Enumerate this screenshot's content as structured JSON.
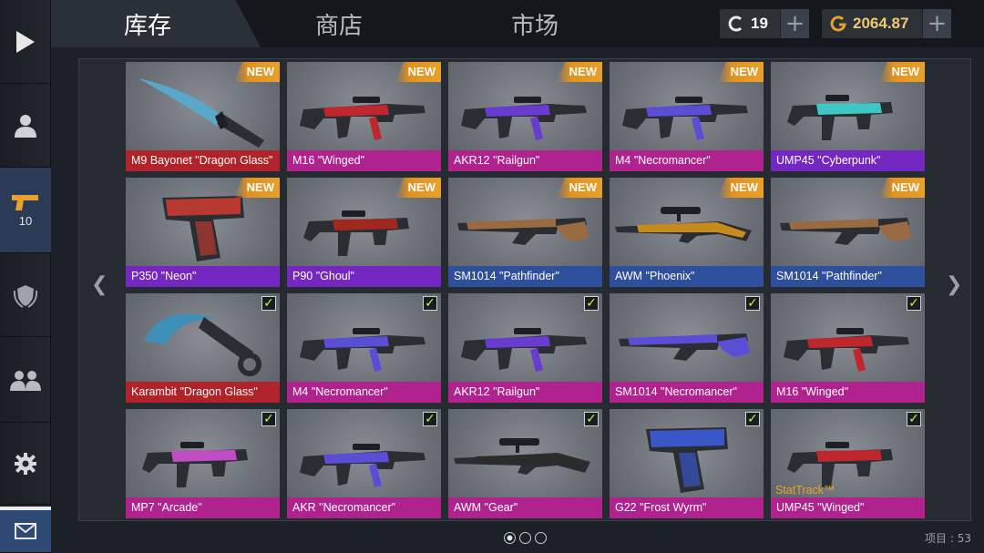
{
  "tabs": [
    {
      "label": "库存",
      "active": true
    },
    {
      "label": "商店",
      "active": false
    },
    {
      "label": "市场",
      "active": false
    }
  ],
  "currency": {
    "credits": {
      "icon": "c-coin-icon",
      "value": "19"
    },
    "gold": {
      "icon": "g-coin-icon",
      "value": "2064.87"
    }
  },
  "sidebar": {
    "items": [
      {
        "name": "play",
        "icon": "play-icon"
      },
      {
        "name": "profile",
        "icon": "person-icon"
      },
      {
        "name": "weapons",
        "icon": "pistol-icon",
        "count": "10",
        "active": true
      },
      {
        "name": "rank",
        "icon": "shield-laurel-icon"
      },
      {
        "name": "friends",
        "icon": "group-icon"
      },
      {
        "name": "settings",
        "icon": "gear-icon"
      },
      {
        "name": "mail",
        "icon": "envelope-icon"
      }
    ]
  },
  "colors": {
    "pink": "#b0238f",
    "violet": "#7527c2",
    "blue": "#2e4f9c",
    "red": "#b0232a",
    "new_badge": "#e8a12b",
    "stattrak": "#e6a52a"
  },
  "items": [
    {
      "name": "M9 Bayonet \"Dragon Glass\"",
      "rarity": "red",
      "badge": "NEW",
      "shape": "knife",
      "accent": "#59a8c9"
    },
    {
      "name": "M16 \"Winged\"",
      "rarity": "pink",
      "badge": "NEW",
      "shape": "rifle",
      "accent": "#c0262e"
    },
    {
      "name": "AKR12 \"Railgun\"",
      "rarity": "pink",
      "badge": "NEW",
      "shape": "rifle",
      "accent": "#6a3bd0"
    },
    {
      "name": "M4 \"Necromancer\"",
      "rarity": "pink",
      "badge": "NEW",
      "shape": "rifle",
      "accent": "#5a4ed6"
    },
    {
      "name": "UMP45 \"Cyberpunk\"",
      "rarity": "violet",
      "badge": "NEW",
      "shape": "smg",
      "accent": "#3ec7c4"
    },
    {
      "name": "P350 \"Neon\"",
      "rarity": "violet",
      "badge": "NEW",
      "shape": "pistol",
      "accent": "#b8392f"
    },
    {
      "name": "P90 \"Ghoul\"",
      "rarity": "violet",
      "badge": "NEW",
      "shape": "smg",
      "accent": "#a0281f"
    },
    {
      "name": "SM1014 \"Pathfinder\"",
      "rarity": "blue",
      "badge": "NEW",
      "shape": "shotgun",
      "accent": "#9a6a42"
    },
    {
      "name": "AWM \"Phoenix\"",
      "rarity": "blue",
      "badge": "NEW",
      "shape": "sniper",
      "accent": "#c78a1c"
    },
    {
      "name": "SM1014 \"Pathfinder\"",
      "rarity": "blue",
      "badge": "NEW",
      "shape": "shotgun",
      "accent": "#9a6a42"
    },
    {
      "name": "Karambit \"Dragon Glass\"",
      "rarity": "red",
      "badge": "check",
      "shape": "karambit",
      "accent": "#3d8fb8"
    },
    {
      "name": "M4 \"Necromancer\"",
      "rarity": "pink",
      "badge": "check",
      "shape": "rifle",
      "accent": "#5a4ed6"
    },
    {
      "name": "AKR12 \"Railgun\"",
      "rarity": "pink",
      "badge": "check",
      "shape": "rifle",
      "accent": "#6a3bd0"
    },
    {
      "name": "SM1014 \"Necromancer\"",
      "rarity": "pink",
      "badge": "check",
      "shape": "shotgun",
      "accent": "#5a4ed6"
    },
    {
      "name": "M16 \"Winged\"",
      "rarity": "pink",
      "badge": "check",
      "shape": "rifle",
      "accent": "#c0262e"
    },
    {
      "name": "MP7 \"Arcade\"",
      "rarity": "pink",
      "badge": "check",
      "shape": "smg",
      "accent": "#c04cc6"
    },
    {
      "name": "AKR \"Necromancer\"",
      "rarity": "pink",
      "badge": "check",
      "shape": "rifle",
      "accent": "#5a4ed6"
    },
    {
      "name": "AWM \"Gear\"",
      "rarity": "pink",
      "badge": "check",
      "shape": "sniper",
      "accent": "#2b2b2b"
    },
    {
      "name": "G22 \"Frost Wyrm\"",
      "rarity": "pink",
      "badge": "check",
      "shape": "pistol",
      "accent": "#3a56c8"
    },
    {
      "name": "UMP45 \"Winged\"",
      "rarity": "pink",
      "badge": "check",
      "shape": "smg",
      "accent": "#c0262e",
      "stattrak": "StatTrack™"
    }
  ],
  "pager": {
    "pages": 3,
    "current": 1
  },
  "footer": {
    "item_count_label": "项目 : 53"
  }
}
